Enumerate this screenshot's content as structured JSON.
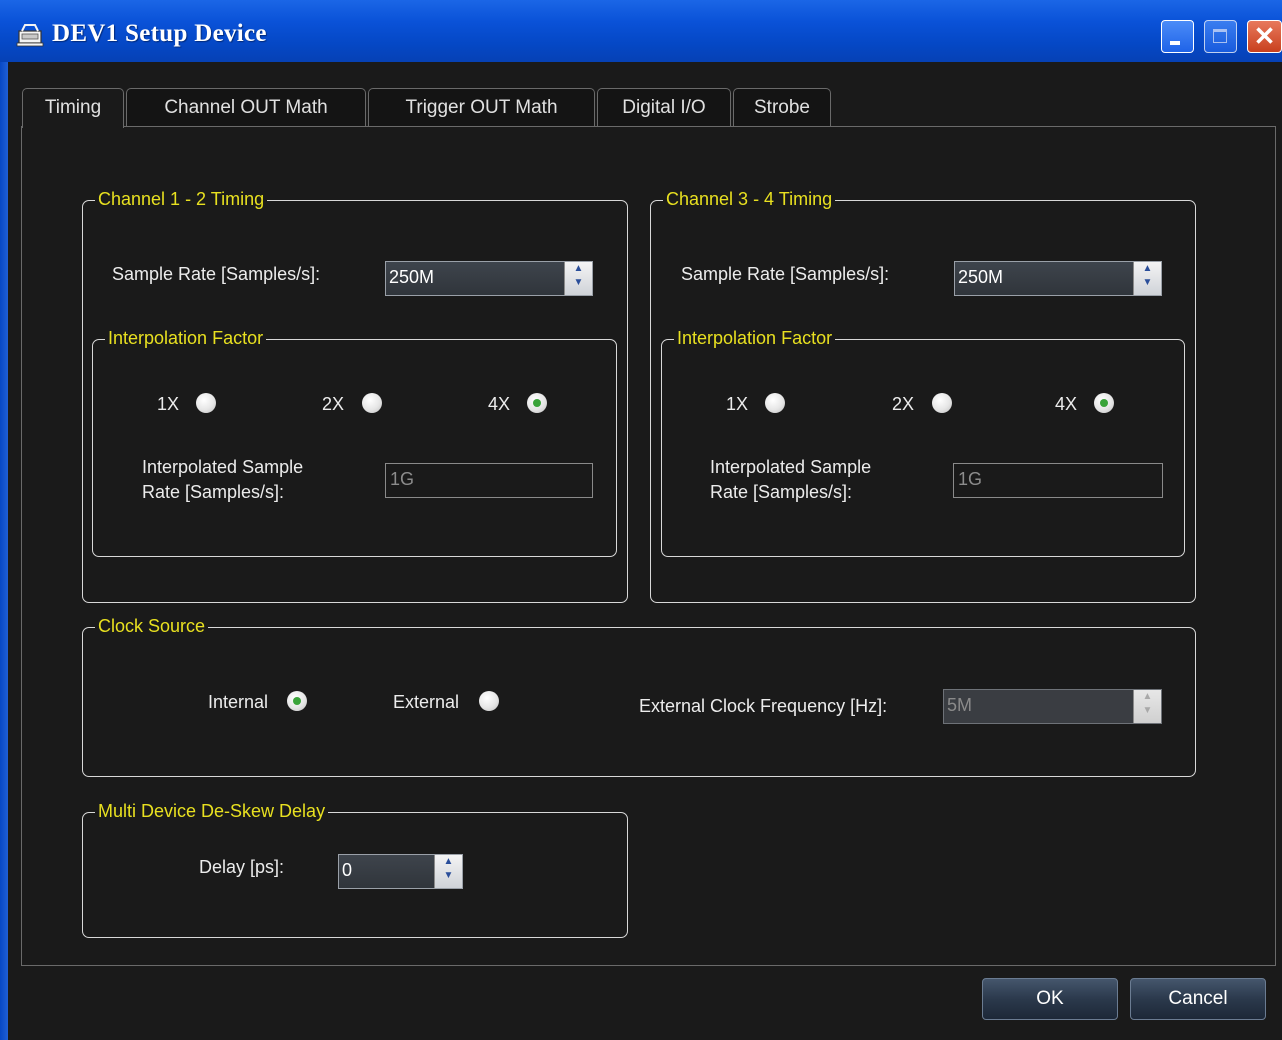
{
  "window": {
    "title": "DEV1 Setup Device"
  },
  "tabs": [
    {
      "label": "Timing",
      "active": true
    },
    {
      "label": "Channel OUT Math",
      "active": false
    },
    {
      "label": "Trigger OUT Math",
      "active": false
    },
    {
      "label": "Digital I/O",
      "active": false
    },
    {
      "label": "Strobe",
      "active": false
    }
  ],
  "ch12": {
    "title": "Channel 1 - 2 Timing",
    "sample_rate_label": "Sample Rate [Samples/s]:",
    "sample_rate_value": "250M",
    "interp_title": "Interpolation Factor",
    "options": [
      "1X",
      "2X",
      "4X"
    ],
    "selected": "4X",
    "interp_rate_label": "Interpolated Sample Rate [Samples/s]:",
    "interp_rate_value": "1G"
  },
  "ch34": {
    "title": "Channel 3 - 4 Timing",
    "sample_rate_label": "Sample Rate [Samples/s]:",
    "sample_rate_value": "250M",
    "interp_title": "Interpolation Factor",
    "options": [
      "1X",
      "2X",
      "4X"
    ],
    "selected": "4X",
    "interp_rate_label": "Interpolated Sample Rate [Samples/s]:",
    "interp_rate_value": "1G"
  },
  "clock": {
    "title": "Clock Source",
    "internal_label": "Internal",
    "external_label": "External",
    "selected": "Internal",
    "ext_freq_label": "External Clock Frequency [Hz]:",
    "ext_freq_value": "5M"
  },
  "deskew": {
    "title": "Multi Device De-Skew Delay",
    "delay_label": "Delay [ps]:",
    "delay_value": "0"
  },
  "buttons": {
    "ok": "OK",
    "cancel": "Cancel"
  },
  "colors": {
    "title_bar": "#0a52d8",
    "group_title": "#e8e020",
    "radio_selected": "#3aa43a",
    "background": "#1a1a1a"
  },
  "icons": {
    "title": "device-setup-icon"
  }
}
